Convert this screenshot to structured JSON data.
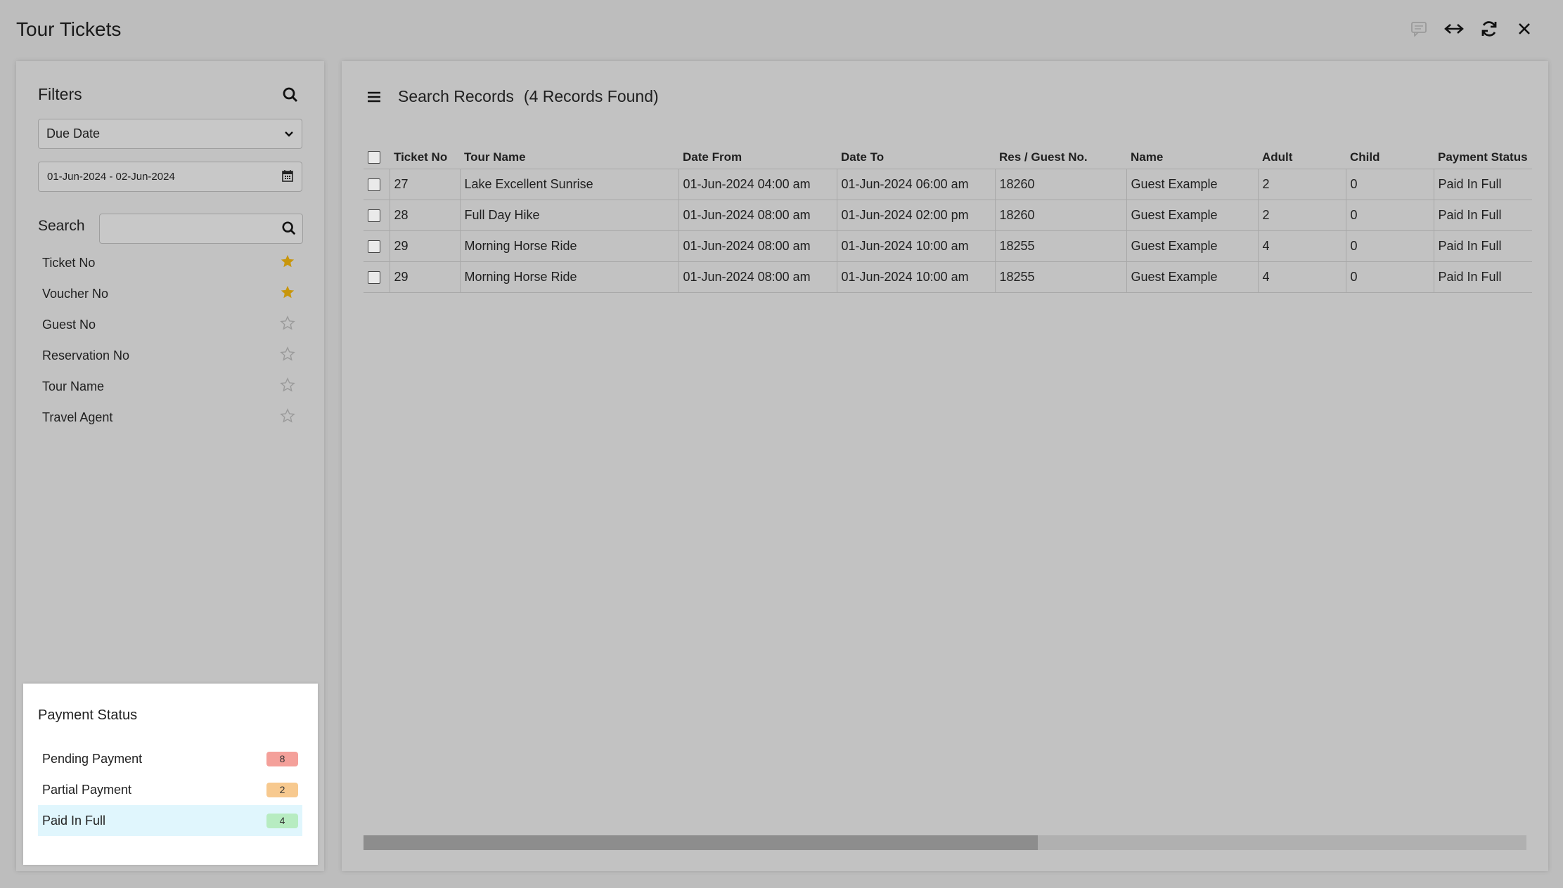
{
  "app": {
    "title": "Tour Tickets"
  },
  "window_controls": [
    {
      "name": "comment-icon"
    },
    {
      "name": "expand-horizontal-icon"
    },
    {
      "name": "refresh-icon"
    },
    {
      "name": "close-icon"
    }
  ],
  "filters": {
    "title": "Filters",
    "date_type": "Due Date",
    "date_range": "01-Jun-2024 - 02-Jun-2024",
    "search_label": "Search",
    "search_value": "",
    "fields": [
      {
        "label": "Ticket No",
        "starred": true
      },
      {
        "label": "Voucher No",
        "starred": true
      },
      {
        "label": "Guest No",
        "starred": false
      },
      {
        "label": "Reservation No",
        "starred": false
      },
      {
        "label": "Tour Name",
        "starred": false
      },
      {
        "label": "Travel Agent",
        "starred": false
      }
    ],
    "star_color": "#c8960c"
  },
  "payment_status": {
    "title": "Payment Status",
    "items": [
      {
        "label": "Pending Payment",
        "count": "8",
        "color": "#f4a09a",
        "active": false
      },
      {
        "label": "Partial Payment",
        "count": "2",
        "color": "#f7c98f",
        "active": false
      },
      {
        "label": "Paid In Full",
        "count": "4",
        "color": "#b7ecc1",
        "active": true
      }
    ]
  },
  "records": {
    "title": "Search Records",
    "count_label": "(4 Records Found)",
    "columns": [
      "Ticket No",
      "Tour Name",
      "Date From",
      "Date To",
      "Res / Guest No.",
      "Name",
      "Adult",
      "Child",
      "Payment Status"
    ],
    "rows": [
      [
        "27",
        "Lake Excellent Sunrise",
        "01-Jun-2024 04:00 am",
        "01-Jun-2024 06:00 am",
        "18260",
        "Guest Example",
        "2",
        "0",
        "Paid In Full"
      ],
      [
        "28",
        "Full Day Hike",
        "01-Jun-2024 08:00 am",
        "01-Jun-2024 02:00 pm",
        "18260",
        "Guest Example",
        "2",
        "0",
        "Paid In Full"
      ],
      [
        "29",
        "Morning Horse Ride",
        "01-Jun-2024 08:00 am",
        "01-Jun-2024 10:00 am",
        "18255",
        "Guest Example",
        "4",
        "0",
        "Paid In Full"
      ],
      [
        "29",
        "Morning Horse Ride",
        "01-Jun-2024 08:00 am",
        "01-Jun-2024 10:00 am",
        "18255",
        "Guest Example",
        "4",
        "0",
        "Paid In Full"
      ]
    ],
    "scroll_position": 0.58
  }
}
